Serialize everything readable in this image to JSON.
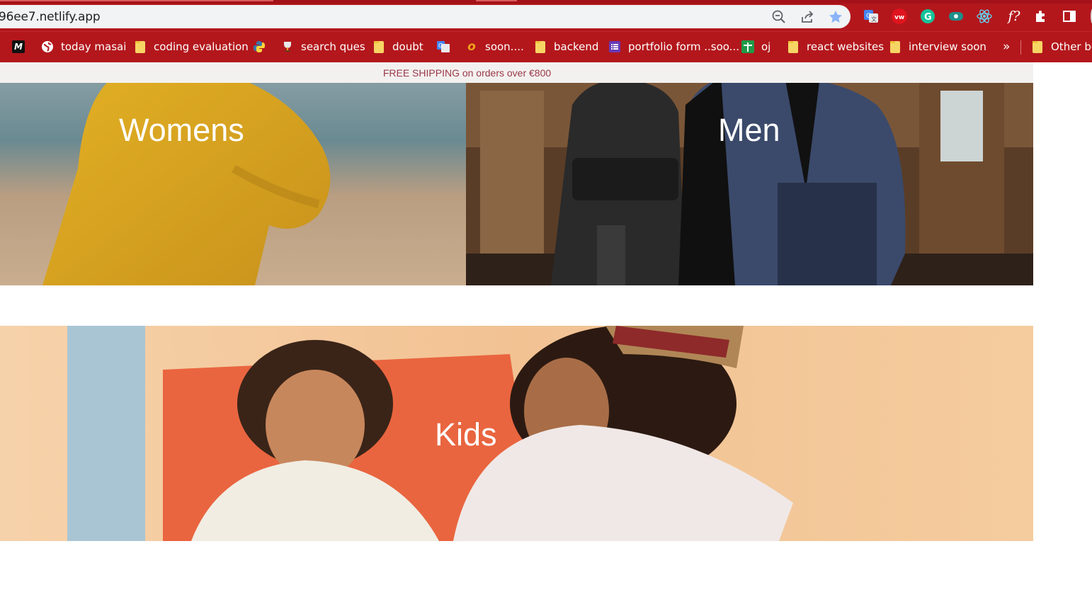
{
  "browser": {
    "url": "96ee7.netlify.app",
    "bookmarks": [
      {
        "label": "",
        "icon": "masai-logo-icon"
      },
      {
        "label": "today masai",
        "icon": "globe-icon"
      },
      {
        "label": "coding evaluation",
        "icon": "folder-icon"
      },
      {
        "label": "",
        "icon": "python-icon"
      },
      {
        "label": "search ques",
        "icon": "trophy-icon"
      },
      {
        "label": "doubt",
        "icon": "folder-icon"
      },
      {
        "label": "",
        "icon": "translate-icon"
      },
      {
        "label": "soon....",
        "icon": "orange-o-icon"
      },
      {
        "label": "backend",
        "icon": "folder-icon"
      },
      {
        "label": "portfolio form ..soo...",
        "icon": "forms-icon"
      },
      {
        "label": "oj",
        "icon": "green-plus-icon"
      },
      {
        "label": "react websites",
        "icon": "folder-icon"
      },
      {
        "label": "interview soon",
        "icon": "folder-icon"
      }
    ],
    "more_label": "»",
    "other_bookmarks": "Other bo",
    "extension_text": "f?"
  },
  "banner": {
    "text": "FREE SHIPPING on orders over €800"
  },
  "categories": [
    {
      "label": "Womens"
    },
    {
      "label": "Men"
    },
    {
      "label": "Kids"
    }
  ],
  "colors": {
    "chrome": "#b3171c",
    "banner_text": "#9a3848",
    "womens_dress": "#d7a418",
    "kids_bg": "#f3c89a"
  }
}
